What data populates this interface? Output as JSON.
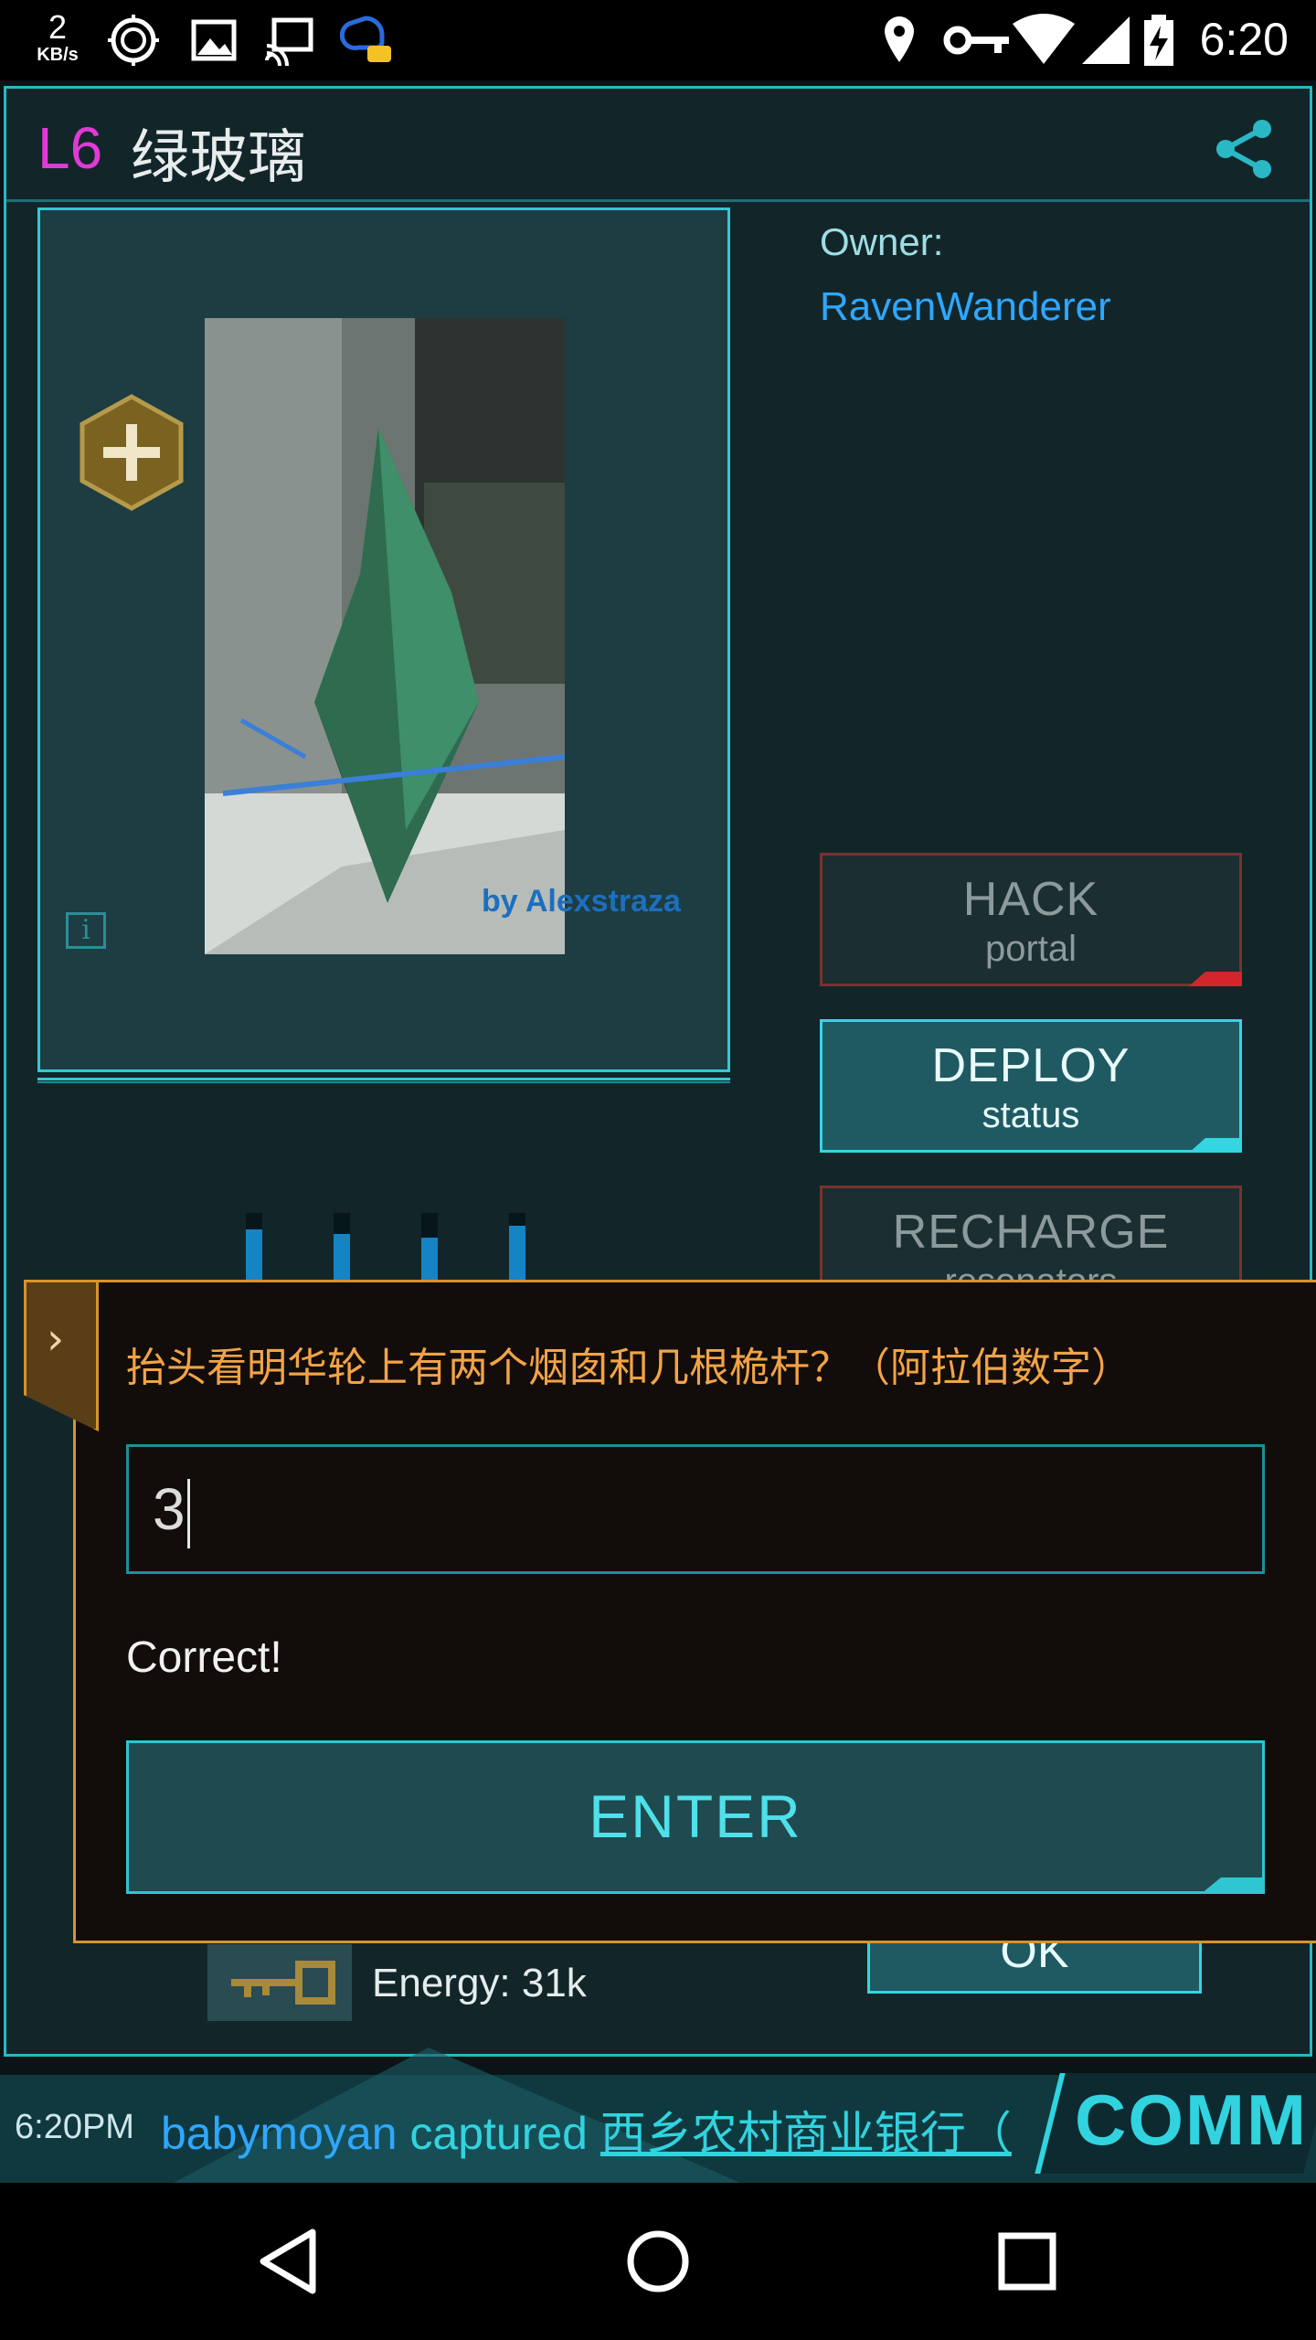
{
  "status_bar": {
    "speed_value": "2",
    "speed_unit": "KB/s",
    "time": "6:20",
    "icons": [
      "speed-indicator",
      "cpu-icon",
      "gallery-icon",
      "cast-icon",
      "chat-bubble-icon",
      "location-icon",
      "key-icon",
      "wifi-icon",
      "signal-icon",
      "battery-icon"
    ]
  },
  "portal": {
    "level": "L6",
    "name": "绿玻璃",
    "owner_label": "Owner:",
    "owner_name": "RavenWanderer",
    "photo_credit": "by Alexstraza",
    "resonator_levels": [
      0.8,
      0.75,
      0.7,
      0.85
    ]
  },
  "actions": {
    "hack_main": "HACK",
    "hack_sub": "portal",
    "deploy_main": "DEPLOY",
    "deploy_sub": "status",
    "recharge_main": "RECHARGE",
    "recharge_sub": "resonators"
  },
  "footer": {
    "energy": "Energy: 31k",
    "ok_label": "OK"
  },
  "dialog": {
    "question": "抬头看明华轮上有两个烟囱和几根桅杆？（阿拉伯数字）",
    "answer_value": "3",
    "result": "Correct!",
    "enter_label": "ENTER"
  },
  "comm": {
    "time": "6:20PM",
    "user": "babymoyan",
    "verb": "captured",
    "portal": "西乡农村商业银行（",
    "button_label": "COMM"
  },
  "colors": {
    "accent_cyan": "#31d3df",
    "dialog_border": "#d8932a",
    "question_orange": "#f2a347",
    "level_magenta": "#e23ad6",
    "owner_blue": "#2fa7ff"
  }
}
